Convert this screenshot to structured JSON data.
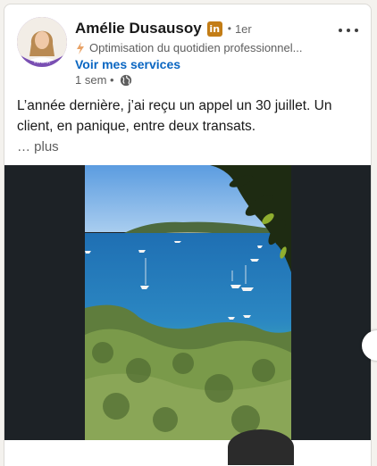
{
  "post": {
    "author": {
      "name": "Amélie Dusausoy",
      "badge": "in",
      "degree": "1er",
      "headline": "Optimisation du quotidien professionnel...",
      "services_link": "Voir mes services",
      "avatar_badge_text": "#WORK",
      "time": "1 sem •"
    },
    "text": "L’année dernière, j’ai reçu un appel un 30 juillet. Un client, en panique, entre deux transats.",
    "see_more": "… plus"
  },
  "colors": {
    "link": "#0a66c2",
    "premium_badge": "#c37d16",
    "avatar_ring": "#7a4fb3",
    "media_background": "#1d2226"
  },
  "icons": [
    "spark-icon",
    "globe-icon",
    "more-icon",
    "premium-badge-icon"
  ]
}
